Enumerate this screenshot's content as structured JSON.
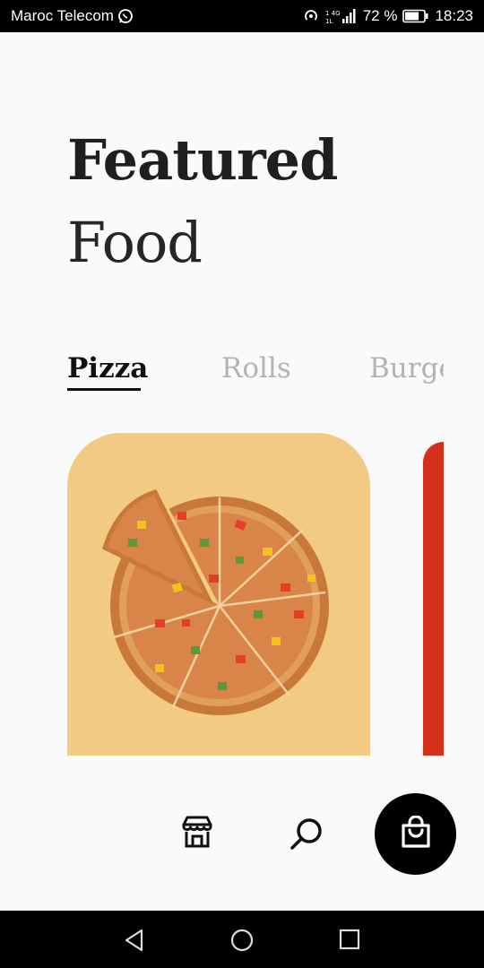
{
  "status_bar": {
    "carrier": "Maroc Telecom",
    "battery_percent": "72 %",
    "time": "18:23",
    "icons": [
      "whatsapp-icon",
      "hotspot-icon",
      "signal-icon",
      "battery-icon"
    ]
  },
  "header": {
    "title_line1": "Featured",
    "title_line2": "Food"
  },
  "categories": {
    "tabs": [
      {
        "label": "Pizza",
        "active": true
      },
      {
        "label": "Rolls",
        "active": false
      },
      {
        "label": "Burge",
        "active": false
      }
    ]
  },
  "cards": [
    {
      "item": "pizza",
      "background": "#f3ca84"
    },
    {
      "item": "partial-card",
      "background": "#d52f19"
    }
  ],
  "bottom_nav": {
    "items": [
      "store-icon",
      "search-icon",
      "shopping-bag-icon"
    ]
  },
  "system_nav": {
    "items": [
      "back-icon",
      "home-icon",
      "recents-icon"
    ]
  }
}
